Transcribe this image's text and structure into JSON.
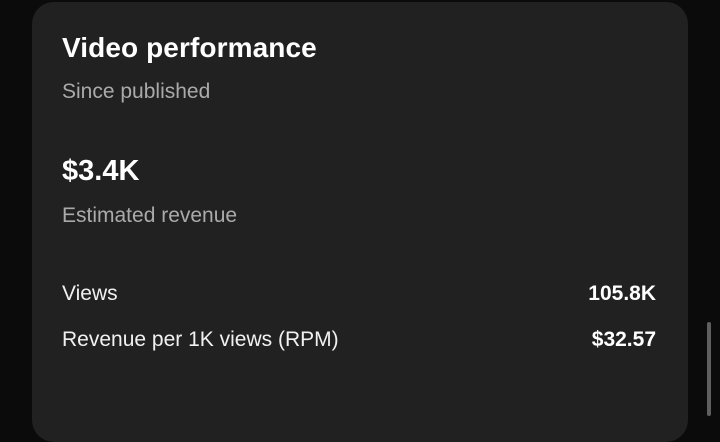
{
  "card": {
    "title": "Video performance",
    "subtitle": "Since published"
  },
  "revenue": {
    "value": "$3.4K",
    "label": "Estimated revenue"
  },
  "metrics": [
    {
      "label": "Views",
      "value": "105.8K"
    },
    {
      "label": "Revenue per 1K views (RPM)",
      "value": "$32.57"
    }
  ],
  "colors": {
    "background": "#0b0b0b",
    "card": "#212121",
    "secondary_text": "#aaaaaa",
    "primary_text": "#ffffff"
  }
}
